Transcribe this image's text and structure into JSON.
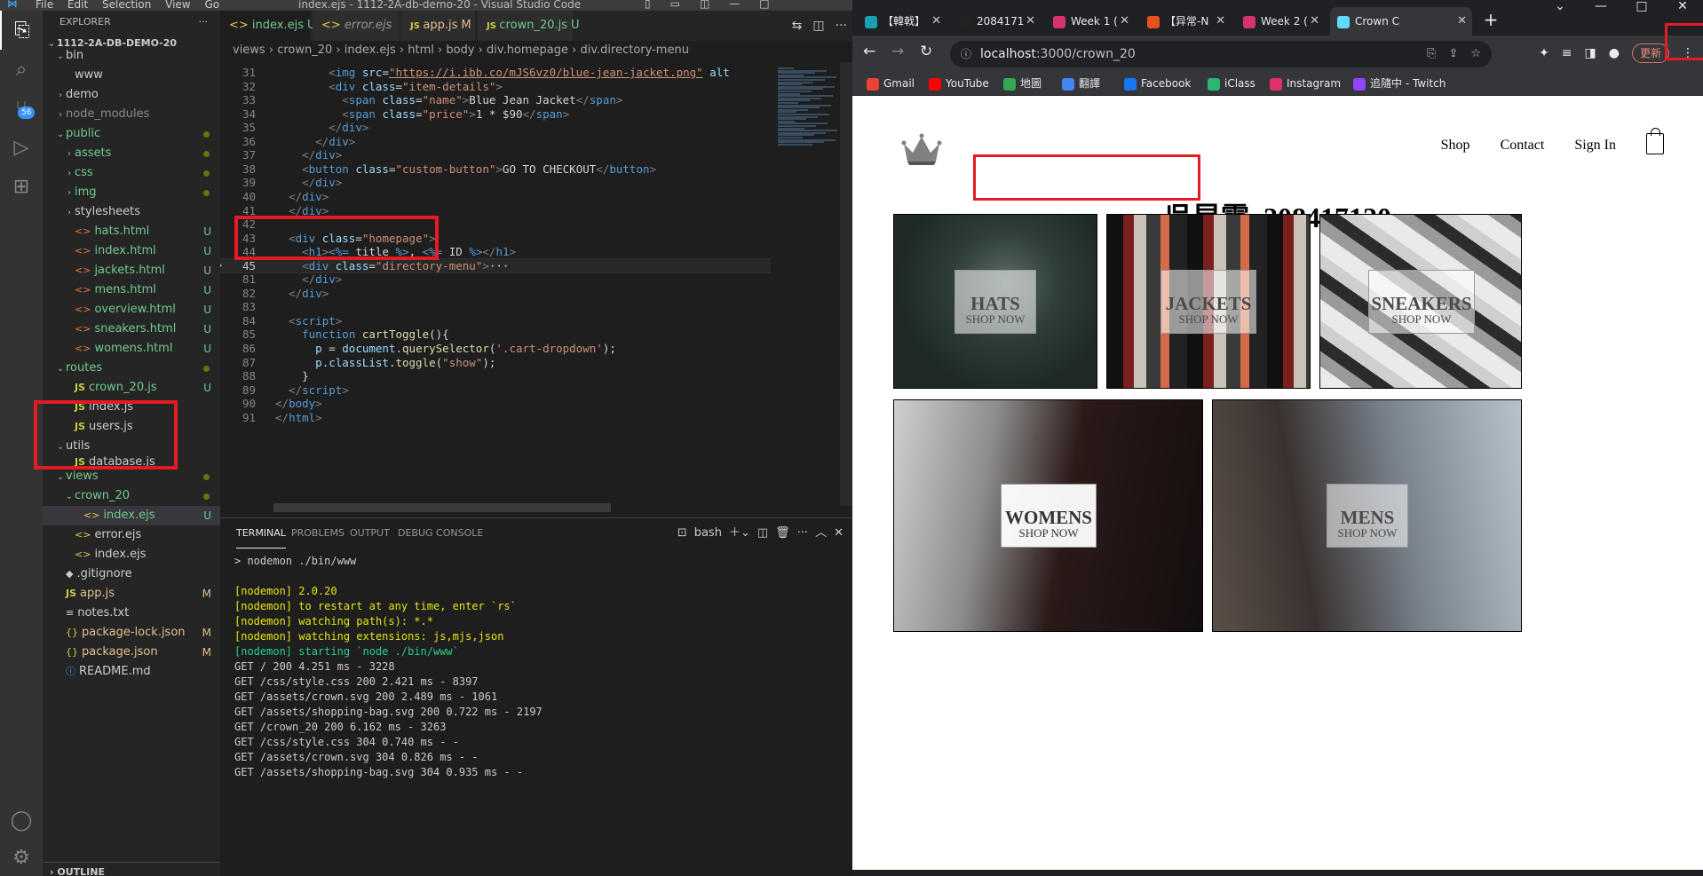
{
  "vscode": {
    "title": "index.ejs - 1112-2A-db-demo-20 - Visual Studio Code",
    "menu": [
      "File",
      "Edit",
      "Selection",
      "View",
      "Go"
    ],
    "activity": {
      "scm_badge": "56"
    },
    "explorer": {
      "header": "EXPLORER",
      "root": "1112-2A-DB-DEMO-20",
      "items": [
        {
          "label": "bin",
          "indent": 1,
          "kind": "folder-open"
        },
        {
          "label": "www",
          "indent": 2,
          "kind": "file"
        },
        {
          "label": "demo",
          "indent": 1,
          "kind": "folder"
        },
        {
          "label": "node_modules",
          "indent": 1,
          "kind": "folder",
          "dim": true
        },
        {
          "label": "public",
          "indent": 1,
          "kind": "folder-open",
          "color": "green",
          "dot": true
        },
        {
          "label": "assets",
          "indent": 2,
          "kind": "folder",
          "color": "green",
          "dot": true
        },
        {
          "label": "css",
          "indent": 2,
          "kind": "folder",
          "color": "green",
          "dot": true
        },
        {
          "label": "img",
          "indent": 2,
          "kind": "folder",
          "color": "green",
          "dot": true
        },
        {
          "label": "stylesheets",
          "indent": 2,
          "kind": "folder"
        },
        {
          "label": "hats.html",
          "indent": 2,
          "kind": "html",
          "color": "green",
          "status": "U"
        },
        {
          "label": "index.html",
          "indent": 2,
          "kind": "html",
          "color": "green",
          "status": "U"
        },
        {
          "label": "jackets.html",
          "indent": 2,
          "kind": "html",
          "color": "green",
          "status": "U"
        },
        {
          "label": "mens.html",
          "indent": 2,
          "kind": "html",
          "color": "green",
          "status": "U"
        },
        {
          "label": "overview.html",
          "indent": 2,
          "kind": "html",
          "color": "green",
          "status": "U"
        },
        {
          "label": "sneakers.html",
          "indent": 2,
          "kind": "html",
          "color": "green",
          "status": "U"
        },
        {
          "label": "womens.html",
          "indent": 2,
          "kind": "html",
          "color": "green",
          "status": "U"
        },
        {
          "label": "routes",
          "indent": 1,
          "kind": "folder-open",
          "color": "green",
          "dot": true
        },
        {
          "label": "crown_20.js",
          "indent": 2,
          "kind": "js",
          "color": "green",
          "status": "U"
        },
        {
          "label": "index.js",
          "indent": 2,
          "kind": "js"
        },
        {
          "label": "users.js",
          "indent": 2,
          "kind": "js"
        },
        {
          "label": "utils",
          "indent": 1,
          "kind": "folder-open"
        },
        {
          "label": "database.js",
          "indent": 2,
          "kind": "js",
          "partial": true
        },
        {
          "label": "views",
          "indent": 1,
          "kind": "folder-open",
          "color": "green",
          "dot": true
        },
        {
          "label": "crown_20",
          "indent": 2,
          "kind": "folder-open",
          "color": "green",
          "dot": true
        },
        {
          "label": "index.ejs",
          "indent": 3,
          "kind": "ejs",
          "color": "green",
          "status": "U",
          "selected": true
        },
        {
          "label": "error.ejs",
          "indent": 2,
          "kind": "ejs"
        },
        {
          "label": "index.ejs",
          "indent": 2,
          "kind": "ejs"
        },
        {
          "label": ".gitignore",
          "indent": 1,
          "kind": "git"
        },
        {
          "label": "app.js",
          "indent": 1,
          "kind": "js",
          "color": "mod",
          "status": "M"
        },
        {
          "label": "notes.txt",
          "indent": 1,
          "kind": "txt"
        },
        {
          "label": "package-lock.json",
          "indent": 1,
          "kind": "json",
          "color": "mod",
          "status": "M"
        },
        {
          "label": "package.json",
          "indent": 1,
          "kind": "json",
          "color": "mod",
          "status": "M"
        },
        {
          "label": "README.md",
          "indent": 1,
          "kind": "md"
        }
      ],
      "outline": "OUTLINE"
    },
    "tabs": [
      {
        "label": "index.ejs",
        "status": "U",
        "active": true,
        "kind": "ejs"
      },
      {
        "label": "error.ejs",
        "status": "",
        "active": false,
        "kind": "ejs"
      },
      {
        "label": "app.js",
        "status": "M",
        "active": false,
        "kind": "js"
      },
      {
        "label": "crown_20.js",
        "status": "U",
        "active": false,
        "kind": "js"
      }
    ],
    "breadcrumb": [
      "views",
      "crown_20",
      "index.ejs",
      "html",
      "body",
      "div.homepage",
      "div.directory-menu"
    ],
    "code": [
      {
        "n": "31",
        "segs": [
          [
            "t",
            "        "
          ],
          [
            "pu",
            "<"
          ],
          [
            "tg",
            "img"
          ],
          [
            "t",
            " "
          ],
          [
            "at",
            "src"
          ],
          [
            "t",
            "="
          ],
          [
            "ur",
            "\"https://i.ibb.co/mJS6vz0/blue-jean-jacket.png\""
          ],
          [
            "t",
            " "
          ],
          [
            "at",
            "alt"
          ]
        ]
      },
      {
        "n": "32",
        "segs": [
          [
            "t",
            "        "
          ],
          [
            "pu",
            "<"
          ],
          [
            "tg",
            "div"
          ],
          [
            "t",
            " "
          ],
          [
            "at",
            "class"
          ],
          [
            "t",
            "="
          ],
          [
            "sv",
            "\"item-details\""
          ],
          [
            "pu",
            ">"
          ]
        ]
      },
      {
        "n": "33",
        "segs": [
          [
            "t",
            "          "
          ],
          [
            "pu",
            "<"
          ],
          [
            "tg",
            "span"
          ],
          [
            "t",
            " "
          ],
          [
            "at",
            "class"
          ],
          [
            "t",
            "="
          ],
          [
            "sv",
            "\"name\""
          ],
          [
            "pu",
            ">"
          ],
          [
            "t",
            "Blue Jean Jacket"
          ],
          [
            "pu",
            "</"
          ],
          [
            "tg",
            "span"
          ],
          [
            "pu",
            ">"
          ]
        ]
      },
      {
        "n": "34",
        "segs": [
          [
            "t",
            "          "
          ],
          [
            "pu",
            "<"
          ],
          [
            "tg",
            "span"
          ],
          [
            "t",
            " "
          ],
          [
            "at",
            "class"
          ],
          [
            "t",
            "="
          ],
          [
            "sv",
            "\"price\""
          ],
          [
            "pu",
            ">"
          ],
          [
            "t",
            "1 * $90"
          ],
          [
            "pu",
            "</"
          ],
          [
            "tg",
            "span"
          ],
          [
            "pu",
            ">"
          ]
        ]
      },
      {
        "n": "35",
        "segs": [
          [
            "t",
            "        "
          ],
          [
            "pu",
            "</"
          ],
          [
            "tg",
            "div"
          ],
          [
            "pu",
            ">"
          ]
        ]
      },
      {
        "n": "36",
        "segs": [
          [
            "t",
            "      "
          ],
          [
            "pu",
            "</"
          ],
          [
            "tg",
            "div"
          ],
          [
            "pu",
            ">"
          ]
        ]
      },
      {
        "n": "37",
        "segs": [
          [
            "t",
            "    "
          ],
          [
            "pu",
            "</"
          ],
          [
            "tg",
            "div"
          ],
          [
            "pu",
            ">"
          ]
        ]
      },
      {
        "n": "38",
        "segs": [
          [
            "t",
            "    "
          ],
          [
            "pu",
            "<"
          ],
          [
            "tg",
            "button"
          ],
          [
            "t",
            " "
          ],
          [
            "at",
            "class"
          ],
          [
            "t",
            "="
          ],
          [
            "sv",
            "\"custom-button\""
          ],
          [
            "pu",
            ">"
          ],
          [
            "t",
            "GO TO CHECKOUT"
          ],
          [
            "pu",
            "</"
          ],
          [
            "tg",
            "button"
          ],
          [
            "pu",
            ">"
          ]
        ]
      },
      {
        "n": "39",
        "segs": [
          [
            "t",
            "    "
          ],
          [
            "pu",
            "</"
          ],
          [
            "tg",
            "div"
          ],
          [
            "pu",
            ">"
          ]
        ]
      },
      {
        "n": "40",
        "segs": [
          [
            "t",
            "  "
          ],
          [
            "pu",
            "</"
          ],
          [
            "tg",
            "div"
          ],
          [
            "pu",
            ">"
          ]
        ]
      },
      {
        "n": "41",
        "segs": [
          [
            "t",
            "  "
          ],
          [
            "pu",
            "</"
          ],
          [
            "tg",
            "div"
          ],
          [
            "pu",
            ">"
          ]
        ]
      },
      {
        "n": "42",
        "segs": []
      },
      {
        "n": "43",
        "segs": [
          [
            "t",
            "  "
          ],
          [
            "pu",
            "<"
          ],
          [
            "tg",
            "div"
          ],
          [
            "t",
            " "
          ],
          [
            "at",
            "class"
          ],
          [
            "t",
            "="
          ],
          [
            "sv",
            "\"homepage\""
          ],
          [
            "pu",
            ">"
          ]
        ]
      },
      {
        "n": "44",
        "segs": [
          [
            "t",
            "    "
          ],
          [
            "pu",
            "<"
          ],
          [
            "tg",
            "h1"
          ],
          [
            "pu",
            ">"
          ],
          [
            "kw",
            "<%="
          ],
          [
            "t",
            " title "
          ],
          [
            "kw",
            "%>"
          ],
          [
            "t",
            ", "
          ],
          [
            "kw",
            "<%="
          ],
          [
            "t",
            " ID "
          ],
          [
            "kw",
            "%>"
          ],
          [
            "pu",
            "</"
          ],
          [
            "tg",
            "h1"
          ],
          [
            "pu",
            ">"
          ]
        ]
      },
      {
        "n": "45",
        "cur": true,
        "fold": true,
        "segs": [
          [
            "t",
            "    "
          ],
          [
            "pu",
            "<"
          ],
          [
            "tg",
            "div"
          ],
          [
            "t",
            " "
          ],
          [
            "at",
            "class"
          ],
          [
            "t",
            "="
          ],
          [
            "sv",
            "\"directory-menu\""
          ],
          [
            "pu",
            ">"
          ],
          [
            "t",
            "···"
          ]
        ]
      },
      {
        "n": "81",
        "segs": [
          [
            "t",
            "    "
          ],
          [
            "pu",
            "</"
          ],
          [
            "tg",
            "div"
          ],
          [
            "pu",
            ">"
          ]
        ]
      },
      {
        "n": "82",
        "segs": [
          [
            "t",
            "  "
          ],
          [
            "pu",
            "</"
          ],
          [
            "tg",
            "div"
          ],
          [
            "pu",
            ">"
          ]
        ]
      },
      {
        "n": "83",
        "segs": []
      },
      {
        "n": "84",
        "segs": [
          [
            "t",
            "  "
          ],
          [
            "pu",
            "<"
          ],
          [
            "tg",
            "script"
          ],
          [
            "pu",
            ">"
          ]
        ]
      },
      {
        "n": "85",
        "segs": [
          [
            "t",
            "    "
          ],
          [
            "kw",
            "function"
          ],
          [
            "t",
            " "
          ],
          [
            "fn",
            "cartToggle"
          ],
          [
            "t",
            "(){"
          ]
        ]
      },
      {
        "n": "86",
        "segs": [
          [
            "t",
            "      "
          ],
          [
            "at",
            "p"
          ],
          [
            "t",
            " = "
          ],
          [
            "at",
            "document"
          ],
          [
            "t",
            "."
          ],
          [
            "fn",
            "querySelector"
          ],
          [
            "t",
            "("
          ],
          [
            "sv",
            "'.cart-dropdown'"
          ],
          [
            "t",
            ");"
          ]
        ]
      },
      {
        "n": "87",
        "segs": [
          [
            "t",
            "      "
          ],
          [
            "at",
            "p"
          ],
          [
            "t",
            "."
          ],
          [
            "at",
            "classList"
          ],
          [
            "t",
            "."
          ],
          [
            "fn",
            "toggle"
          ],
          [
            "t",
            "("
          ],
          [
            "sv",
            "\"show\""
          ],
          [
            "t",
            ");"
          ]
        ]
      },
      {
        "n": "88",
        "segs": [
          [
            "t",
            "    }"
          ]
        ]
      },
      {
        "n": "89",
        "segs": [
          [
            "t",
            "  "
          ],
          [
            "pu",
            "</"
          ],
          [
            "tg",
            "script"
          ],
          [
            "pu",
            ">"
          ]
        ]
      },
      {
        "n": "90",
        "segs": [
          [
            "pu",
            "</"
          ],
          [
            "tg",
            "body"
          ],
          [
            "pu",
            ">"
          ]
        ]
      },
      {
        "n": "91",
        "segs": [
          [
            "pu",
            "</"
          ],
          [
            "tg",
            "html"
          ],
          [
            "pu",
            ">"
          ]
        ]
      }
    ],
    "panel": {
      "tabs": [
        "TERMINAL",
        "PROBLEMS",
        "OUTPUT",
        "DEBUG CONSOLE"
      ],
      "shell": "bash",
      "lines": [
        {
          "c": "",
          "t": "> nodemon ./bin/www"
        },
        {
          "c": "",
          "t": ""
        },
        {
          "c": "y",
          "t": "[nodemon] 2.0.20"
        },
        {
          "c": "y",
          "t": "[nodemon] to restart at any time, enter `rs`"
        },
        {
          "c": "y",
          "t": "[nodemon] watching path(s): *.*"
        },
        {
          "c": "y",
          "t": "[nodemon] watching extensions: js,mjs,json"
        },
        {
          "c": "g",
          "t": "[nodemon] starting `node ./bin/www`"
        },
        {
          "c": "",
          "t": "GET / 200 4.251 ms - 3228"
        },
        {
          "c": "",
          "t": "GET /css/style.css 200 2.421 ms - 8397"
        },
        {
          "c": "",
          "t": "GET /assets/crown.svg 200 2.489 ms - 1061"
        },
        {
          "c": "",
          "t": "GET /assets/shopping-bag.svg 200 0.722 ms - 2197"
        },
        {
          "c": "",
          "t": "GET /crown_20 200 6.162 ms - 3263"
        },
        {
          "c": "",
          "t": "GET /css/style.css 304 0.740 ms - -"
        },
        {
          "c": "",
          "t": "GET /assets/crown.svg 304 0.826 ms - -"
        },
        {
          "c": "",
          "t": "GET /assets/shopping-bag.svg 304 0.935 ms - -"
        }
      ]
    }
  },
  "browser": {
    "tabs": [
      {
        "label": "【韓戟】",
        "color": "#1a9fb5"
      },
      {
        "label": "2084171",
        "color": "#222"
      },
      {
        "label": "Week 1 (",
        "color": "#d6336c"
      },
      {
        "label": "【异常-N",
        "color": "#e8501c"
      },
      {
        "label": "Week 2 (",
        "color": "#d6336c"
      },
      {
        "label": "Crown C",
        "color": "#61dafb",
        "active": true
      }
    ],
    "address": {
      "host": "localhost",
      "path": ":3000/crown_20"
    },
    "update_label": "更新",
    "bookmarks": [
      {
        "label": "Gmail",
        "color": "#ea4335"
      },
      {
        "label": "YouTube",
        "color": "#ff0000"
      },
      {
        "label": "地圖",
        "color": "#34a853"
      },
      {
        "label": "翻譯",
        "color": "#4285f4"
      },
      {
        "label": "Facebook",
        "color": "#1877f2"
      },
      {
        "label": "iClass",
        "color": "#2bb673"
      },
      {
        "label": "Instagram",
        "color": "#e1306c"
      },
      {
        "label": "追隨中 - Twitch",
        "color": "#9146ff"
      }
    ],
    "site": {
      "nav": [
        "Shop",
        "Contact",
        "Sign In"
      ],
      "heading": "吳昱霆, 208417120",
      "tiles": [
        {
          "title": "HATS",
          "sub": "SHOP NOW"
        },
        {
          "title": "JACKETS",
          "sub": "SHOP NOW"
        },
        {
          "title": "SNEAKERS",
          "sub": "SHOP NOW"
        },
        {
          "title": "WOMENS",
          "sub": "SHOP NOW"
        },
        {
          "title": "MENS",
          "sub": "SHOP NOW"
        }
      ]
    }
  }
}
